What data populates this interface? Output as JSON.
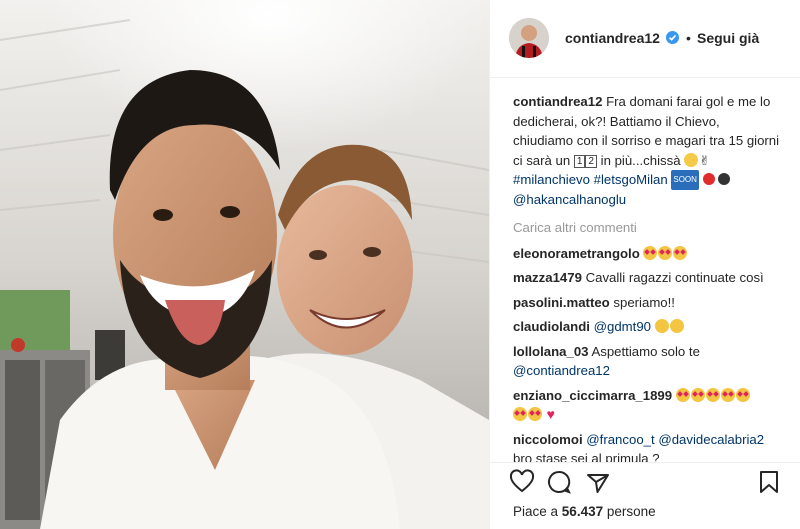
{
  "author": {
    "username": "contiandrea12",
    "separator": "•",
    "follow_label": "Segui già"
  },
  "caption": {
    "username": "contiandrea12",
    "text_part1": "Fra domani farai gol e me lo dedicherai, ok?! Battiamo il Chievo, chiudiamo con il sorriso e magari tra 15 giorni ci sarà un",
    "box_1": "1",
    "box_2": "2",
    "text_part2": "in più...chissà",
    "hashtag1": "#milanchievo",
    "hashtag2": "#letsgoMilan",
    "soon_label": "SOON",
    "mention": "@hakancalhanoglu"
  },
  "load_more_label": "Carica altri commenti",
  "comments": [
    {
      "username": "eleonorametrangolo",
      "text": ""
    },
    {
      "username": "mazza1479",
      "text": "Cavalli ragazzi continuate così"
    },
    {
      "username": "pasolini.matteo",
      "text": "speriamo!!"
    },
    {
      "username": "claudiolandi",
      "mention": "@gdmt90"
    },
    {
      "username": "lollolana_03",
      "text": "Aspettiamo solo te",
      "mention": "@contiandrea12"
    },
    {
      "username": "enziano_ciccimarra_1899",
      "text": ""
    },
    {
      "username": "niccolomoi",
      "mention1": "@francoo_t",
      "mention2": "@davidecalabria2",
      "text": "bro stase sei al primula ?"
    }
  ],
  "likes": {
    "prefix": "Piace a",
    "count": "56.437",
    "suffix": "persone"
  },
  "icons": {
    "like": "heart-icon",
    "comment": "comment-icon",
    "share": "share-icon",
    "save": "bookmark-icon",
    "verified": "verified-badge-icon"
  },
  "colors": {
    "link": "#003569",
    "verified": "#3897f0",
    "muted": "#999999",
    "text": "#262626"
  }
}
